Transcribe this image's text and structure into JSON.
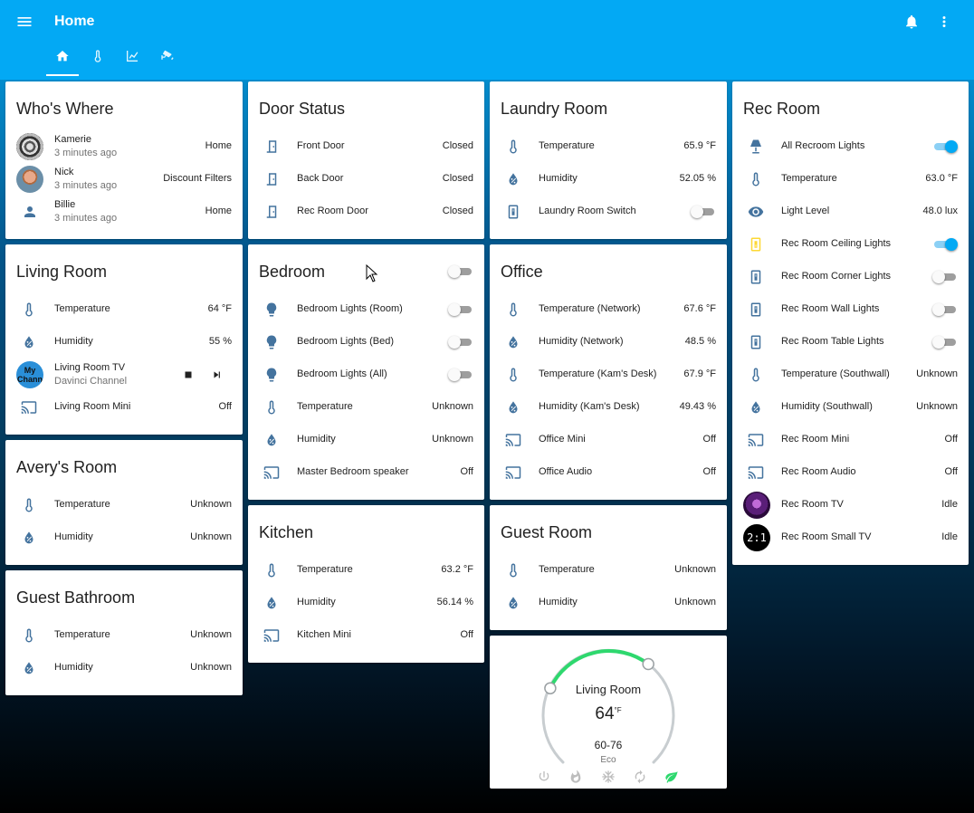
{
  "header": {
    "title": "Home"
  },
  "tabs": [
    {
      "icon": "home-icon"
    },
    {
      "icon": "thermometer-icon"
    },
    {
      "icon": "chart-line-icon"
    },
    {
      "icon": "cctv-icon"
    }
  ],
  "colors": {
    "primary": "#03a9f4",
    "icon": "#44739e",
    "toggle_on": "#03a9f4",
    "thermo_active": "#2ed86e"
  },
  "whos_where": {
    "title": "Who's Where",
    "people": [
      {
        "name": "Kamerie",
        "time": "3 minutes ago",
        "state": "Home"
      },
      {
        "name": "Nick",
        "time": "3 minutes ago",
        "state": "Discount Filters"
      },
      {
        "name": "Billie",
        "time": "3 minutes ago",
        "state": "Home"
      }
    ]
  },
  "living_room": {
    "title": "Living Room",
    "temperature": {
      "label": "Temperature",
      "value": "64 °F"
    },
    "humidity": {
      "label": "Humidity",
      "value": "55 %"
    },
    "tv": {
      "label": "Living Room TV",
      "sub": "Davinci Channel",
      "logo_text": "My Chann"
    },
    "mini": {
      "label": "Living Room Mini",
      "value": "Off"
    }
  },
  "averys_room": {
    "title": "Avery's Room",
    "temperature": {
      "label": "Temperature",
      "value": "Unknown"
    },
    "humidity": {
      "label": "Humidity",
      "value": "Unknown"
    }
  },
  "guest_bathroom": {
    "title": "Guest Bathroom",
    "temperature": {
      "label": "Temperature",
      "value": "Unknown"
    },
    "humidity": {
      "label": "Humidity",
      "value": "Unknown"
    }
  },
  "door_status": {
    "title": "Door Status",
    "doors": [
      {
        "label": "Front Door",
        "value": "Closed"
      },
      {
        "label": "Back Door",
        "value": "Closed"
      },
      {
        "label": "Rec Room Door",
        "value": "Closed"
      }
    ]
  },
  "bedroom": {
    "title": "Bedroom",
    "lights": [
      {
        "label": "Bedroom Lights (Room)"
      },
      {
        "label": "Bedroom Lights (Bed)"
      },
      {
        "label": "Bedroom Lights (All)"
      }
    ],
    "temperature": {
      "label": "Temperature",
      "value": "Unknown"
    },
    "humidity": {
      "label": "Humidity",
      "value": "Unknown"
    },
    "speaker": {
      "label": "Master Bedroom speaker",
      "value": "Off"
    }
  },
  "kitchen": {
    "title": "Kitchen",
    "temperature": {
      "label": "Temperature",
      "value": "63.2 °F"
    },
    "humidity": {
      "label": "Humidity",
      "value": "56.14 %"
    },
    "mini": {
      "label": "Kitchen Mini",
      "value": "Off"
    }
  },
  "laundry_room": {
    "title": "Laundry Room",
    "temperature": {
      "label": "Temperature",
      "value": "65.9 °F"
    },
    "humidity": {
      "label": "Humidity",
      "value": "52.05 %"
    },
    "switch": {
      "label": "Laundry Room Switch"
    }
  },
  "office": {
    "title": "Office",
    "rows": [
      {
        "label": "Temperature (Network)",
        "value": "67.6 °F"
      },
      {
        "label": "Humidity (Network)",
        "value": "48.5 %"
      },
      {
        "label": "Temperature (Kam's Desk)",
        "value": "67.9 °F"
      },
      {
        "label": "Humidity (Kam's Desk)",
        "value": "49.43 %"
      },
      {
        "label": "Office Mini",
        "value": "Off"
      },
      {
        "label": "Office Audio",
        "value": "Off"
      }
    ]
  },
  "guest_room": {
    "title": "Guest Room",
    "temperature": {
      "label": "Temperature",
      "value": "Unknown"
    },
    "humidity": {
      "label": "Humidity",
      "value": "Unknown"
    }
  },
  "thermostat": {
    "name": "Living Room",
    "current": "64",
    "unit": "°F",
    "range": "60-76",
    "mode": "Eco"
  },
  "rec_room": {
    "title": "Rec Room",
    "rows": [
      {
        "label": "All Recroom Lights"
      },
      {
        "label": "Temperature",
        "value": "63.0 °F"
      },
      {
        "label": "Light Level",
        "value": "48.0 lux"
      },
      {
        "label": "Rec Room Ceiling Lights"
      },
      {
        "label": "Rec Room Corner Lights"
      },
      {
        "label": "Rec Room Wall Lights"
      },
      {
        "label": "Rec Room Table Lights"
      },
      {
        "label": "Temperature (Southwall)",
        "value": "Unknown"
      },
      {
        "label": "Humidity (Southwall)",
        "value": "Unknown"
      },
      {
        "label": "Rec Room Mini",
        "value": "Off"
      },
      {
        "label": "Rec Room Audio",
        "value": "Off"
      },
      {
        "label": "Rec Room TV",
        "value": "Idle"
      },
      {
        "label": "Rec Room Small TV",
        "value": "Idle",
        "logo_text": "2:1"
      }
    ]
  }
}
